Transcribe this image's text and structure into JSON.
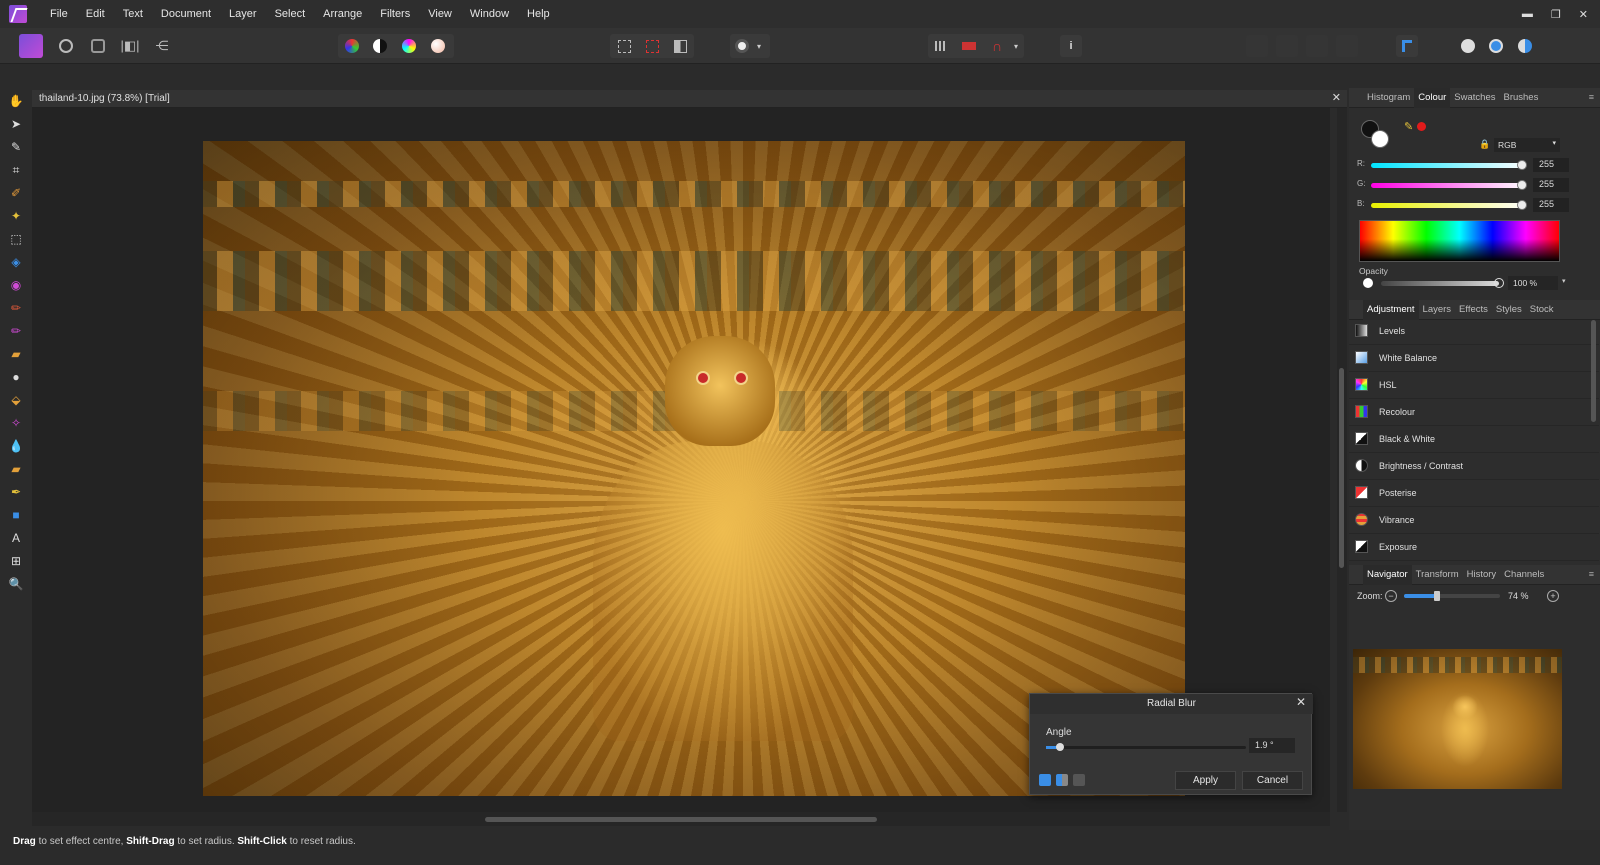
{
  "menu": [
    "File",
    "Edit",
    "Text",
    "Document",
    "Layer",
    "Select",
    "Arrange",
    "Filters",
    "View",
    "Window",
    "Help"
  ],
  "window_controls": {
    "minimize": "▬",
    "restore": "❐",
    "close": "✕"
  },
  "toolbar": {
    "personas": [
      "photo-persona-icon",
      "liquify-persona-icon",
      "develop-persona-icon",
      "tone-mapping-persona-icon",
      "export-persona-icon"
    ],
    "adjust_buttons": [
      "auto-levels-icon",
      "auto-contrast-icon",
      "auto-colour-icon",
      "auto-white-balance-icon"
    ],
    "selection_buttons": [
      "marquee-icon",
      "deselect-icon",
      "invert-selection-icon"
    ],
    "mask_button": "quick-mask-icon"
  },
  "document": {
    "title": "thailand-10.jpg (73.8%) [Trial]",
    "close": "✕"
  },
  "status": {
    "drag": "Drag",
    "drag_text": " to set effect centre, ",
    "shift_drag": "Shift-Drag",
    "shift_drag_text": " to set radius. ",
    "shift_click": "Shift-Click",
    "shift_click_text": " to reset radius."
  },
  "colour_panel": {
    "tabs": [
      "Histogram",
      "Colour",
      "Swatches",
      "Brushes"
    ],
    "active_tab": "Colour",
    "mode": "RGB",
    "r_label": "R:",
    "r_value": "255",
    "g_label": "G:",
    "g_value": "255",
    "b_label": "B:",
    "b_value": "255",
    "opacity_label": "Opacity",
    "opacity_value": "100 %",
    "accent_red": "#e01b1b"
  },
  "adjustment_panel": {
    "tabs": [
      "Adjustment",
      "Layers",
      "Effects",
      "Styles",
      "Stock"
    ],
    "active_tab": "Adjustment",
    "items": [
      "Levels",
      "White Balance",
      "HSL",
      "Recolour",
      "Black & White",
      "Brightness / Contrast",
      "Posterise",
      "Vibrance",
      "Exposure"
    ]
  },
  "navigator_panel": {
    "tabs": [
      "Navigator",
      "Transform",
      "History",
      "Channels"
    ],
    "active_tab": "Navigator",
    "zoom_label": "Zoom:",
    "zoom_value": "74 %"
  },
  "dialog": {
    "title": "Radial Blur",
    "angle_label": "Angle",
    "angle_value": "1.9 °",
    "apply": "Apply",
    "cancel": "Cancel",
    "close": "✕"
  }
}
